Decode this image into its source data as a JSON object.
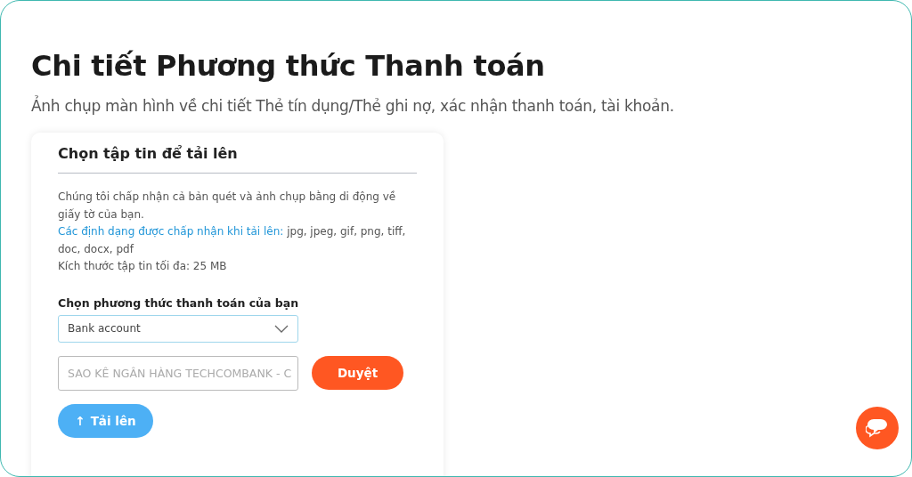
{
  "page": {
    "title": "Chi tiết Phương thức Thanh toán",
    "subtitle": "Ảnh chụp màn hình về chi tiết Thẻ tín dụng/Thẻ ghi nợ, xác nhận thanh toán, tài khoản."
  },
  "upload_card": {
    "heading": "Chọn tập tin để tải lên",
    "info": [
      {
        "kind": "text",
        "text": "Chúng tôi chấp nhận cả bản quét và ảnh chụp bằng di động về giấy tờ của bạn."
      },
      {
        "kind": "formats",
        "link": "Các định dạng được chấp nhận khi tải lên:",
        "text": " jpg, jpeg, gif, png, tiff, doc, docx, pdf"
      },
      {
        "kind": "text",
        "text": "Kích thước tập tin tối đa: 25 MB"
      }
    ],
    "method_label": "Chọn phương thức thanh toán của bạn",
    "method_select": {
      "value": "Bank account"
    },
    "file_field": {
      "value": "SAO KÊ NGÂN HÀNG TECHCOMBANK - C"
    },
    "browse_button": "Duyệt",
    "upload_button": {
      "icon": "↑",
      "label": "Tải lên"
    }
  },
  "chat_button": {
    "kind": "chat"
  }
}
